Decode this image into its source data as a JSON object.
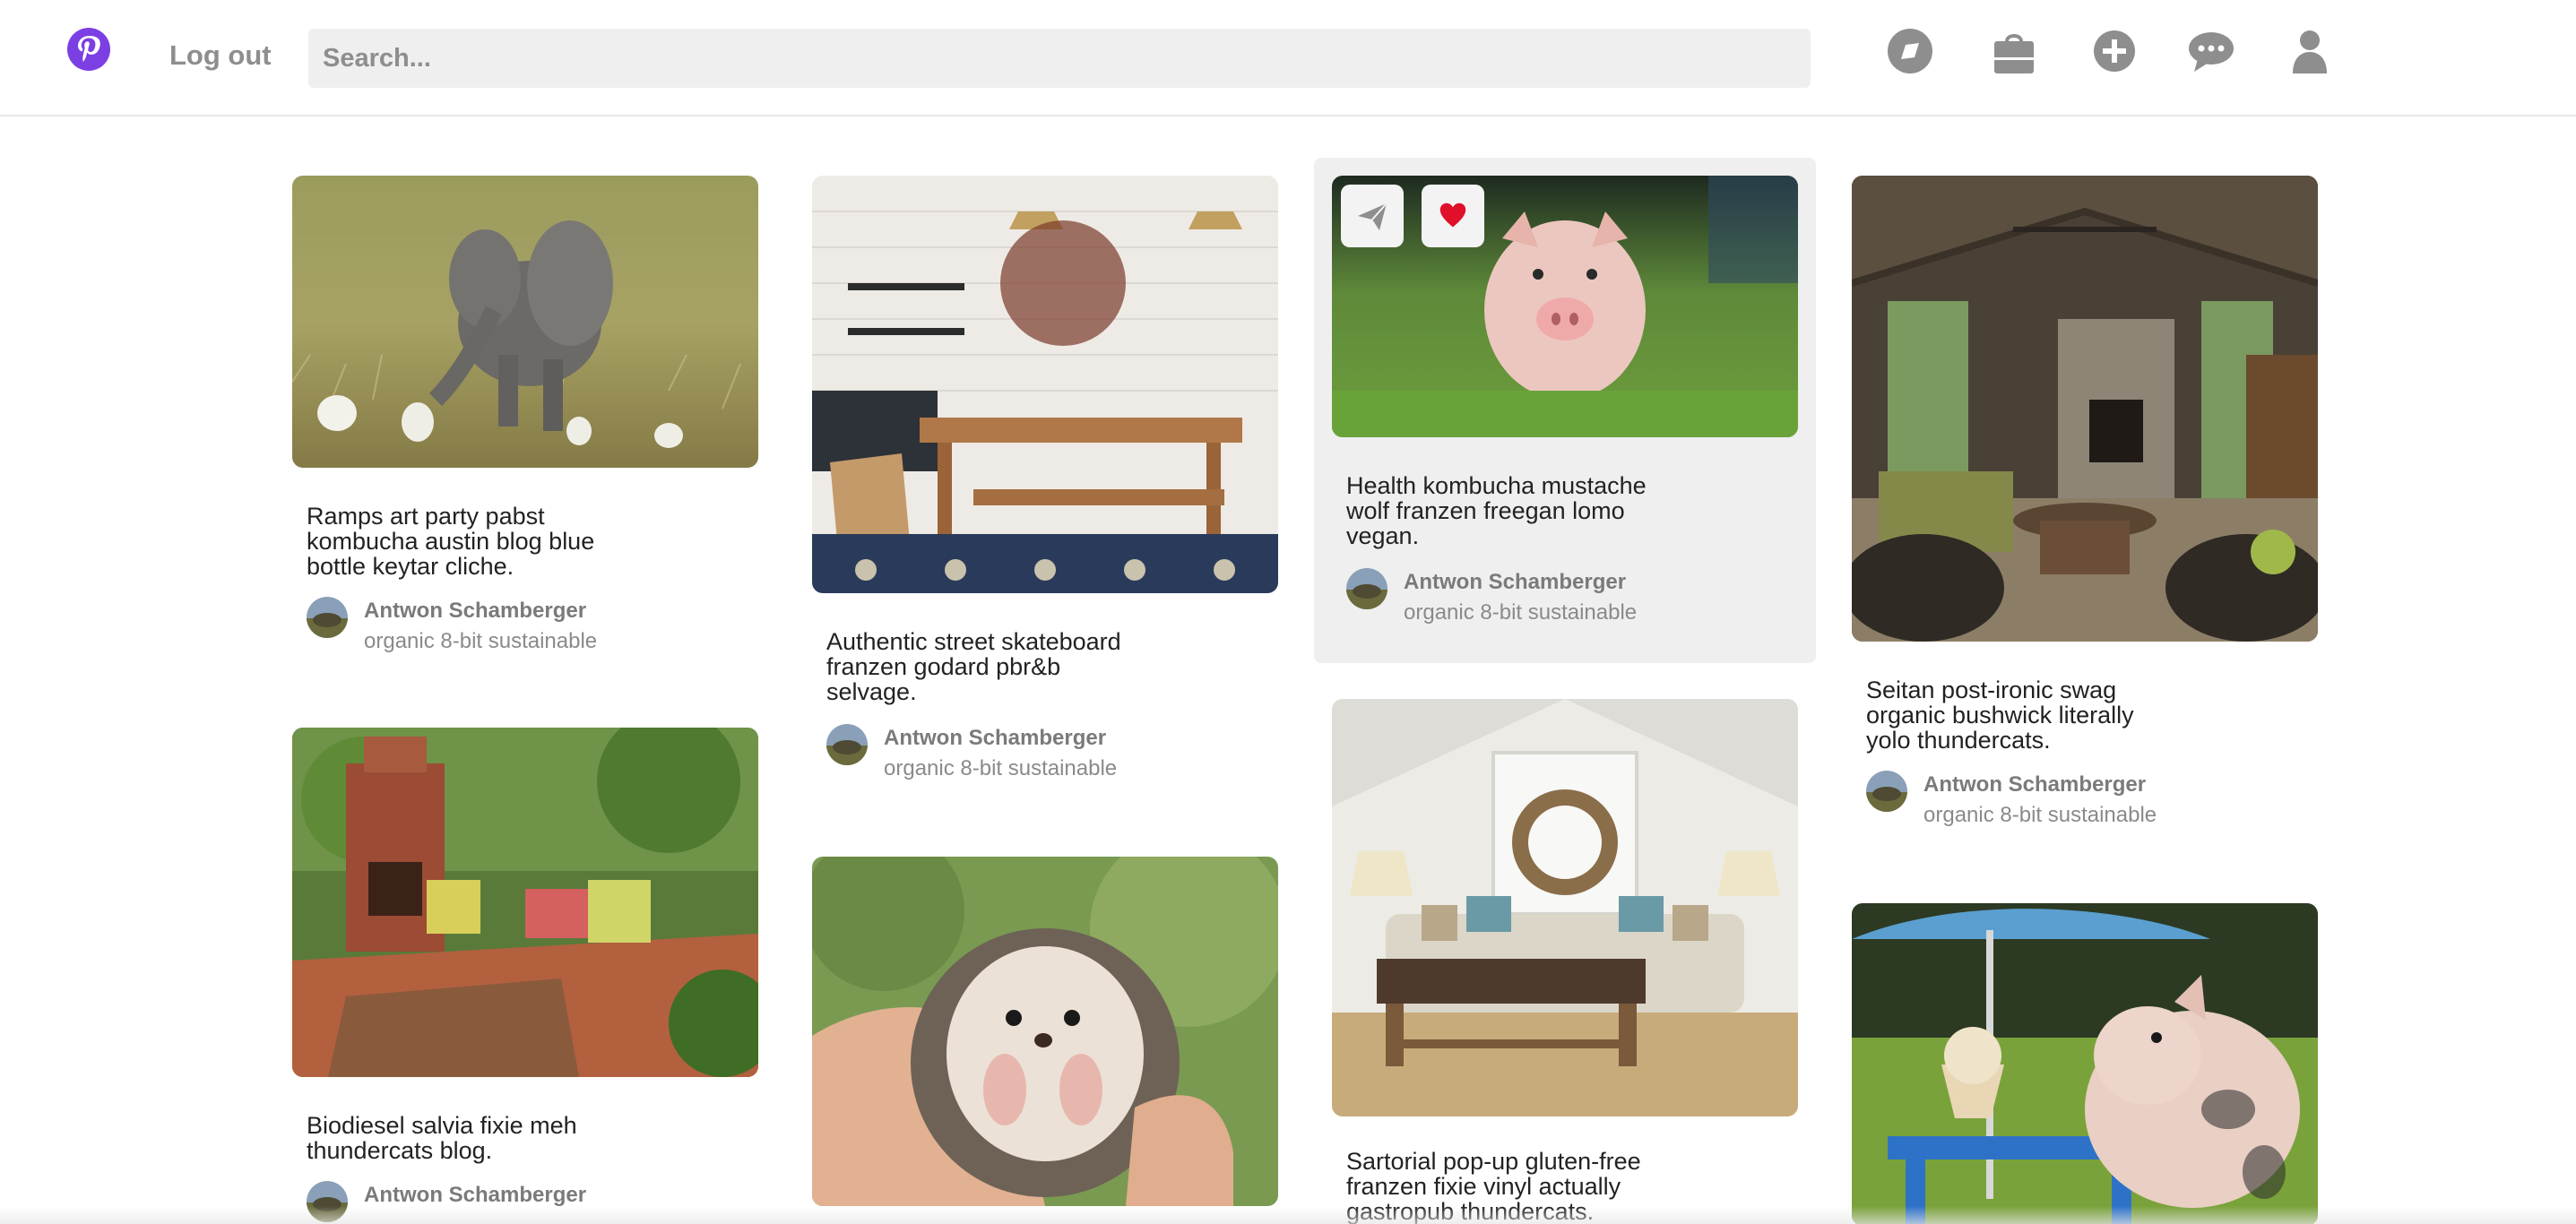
{
  "header": {
    "logout_label": "Log out",
    "search_placeholder": "Search...",
    "icons": [
      "explore-icon",
      "shop-bag-icon",
      "add-icon",
      "messages-icon",
      "profile-icon"
    ],
    "brand_color": "#7b3fe4",
    "icon_color": "#8e8e8e"
  },
  "pins": [
    {
      "caption_lines": [
        "Ramps art party pabst",
        "kombucha austin blog blue",
        "bottle keytar cliche."
      ],
      "author": "Antwon Schamberger",
      "tags": "organic 8-bit sustainable",
      "image": "baby-elephant-in-field"
    },
    {
      "caption_lines": [
        "Biodiesel salvia fixie meh",
        "thundercats blog."
      ],
      "author": "Antwon Schamberger",
      "tags": "",
      "image": "garden-patio-with-brick-fireplace"
    },
    {
      "caption_lines": [
        "Authentic street skateboard",
        "franzen godard pbr&b",
        "selvage."
      ],
      "author": "Antwon Schamberger",
      "tags": "organic 8-bit sustainable",
      "image": "rustic-kitchen-dining-table"
    },
    {
      "caption_lines": [],
      "author": "",
      "tags": "",
      "image": "hedgehog-in-hand"
    },
    {
      "caption_lines": [
        "Health kombucha mustache",
        "wolf franzen freegan lomo",
        "vegan."
      ],
      "author": "Antwon Schamberger",
      "tags": "organic 8-bit sustainable",
      "image": "piglet-on-grass"
    },
    {
      "caption_lines": [
        "Sartorial pop-up gluten-free",
        "franzen fixie vinyl actually",
        "gastropub thundercats."
      ],
      "author": "",
      "tags": "",
      "image": "living-room-with-wreath"
    },
    {
      "caption_lines": [
        "Seitan post-ironic swag",
        "organic bushwick literally",
        "yolo thundercats."
      ],
      "author": "Antwon Schamberger",
      "tags": "organic 8-bit sustainable",
      "image": "covered-porch-with-stone-fireplace"
    },
    {
      "caption_lines": [],
      "author": "",
      "tags": "",
      "image": "piglet-with-ice-cream-at-picnic-table"
    }
  ],
  "hover_actions": [
    "send-icon",
    "heart-icon"
  ],
  "accent_colors": {
    "heart": "#e0102a",
    "hover_card_bg": "#efefef"
  }
}
